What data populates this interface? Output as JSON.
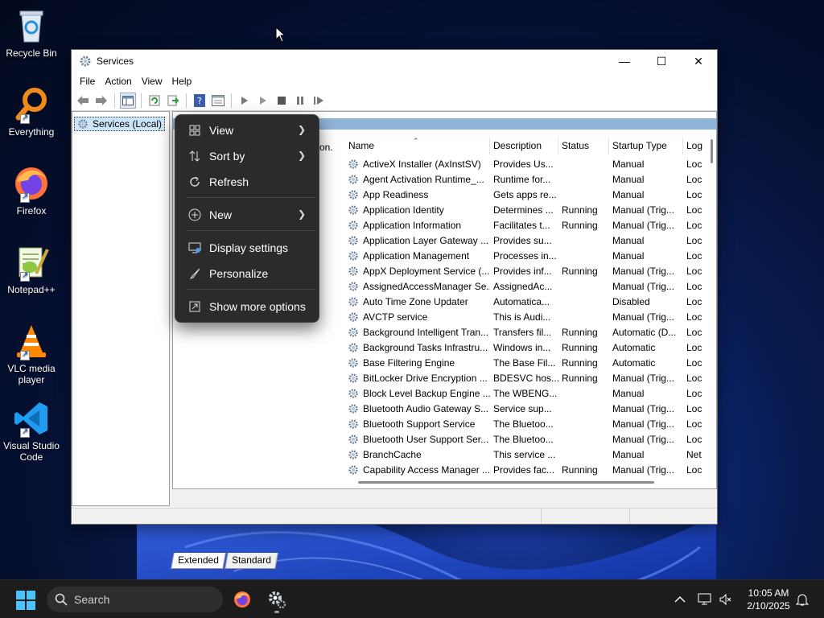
{
  "desktop": {
    "icons": [
      {
        "label": "Recycle Bin",
        "icon": "recycle-bin-icon"
      },
      {
        "label": "Everything",
        "icon": "everything-search-icon"
      },
      {
        "label": "Firefox",
        "icon": "firefox-icon"
      },
      {
        "label": "Notepad++",
        "icon": "notepadpp-icon"
      },
      {
        "label": "VLC media player",
        "icon": "vlc-icon"
      },
      {
        "label": "Visual Studio Code",
        "icon": "vscode-icon"
      }
    ]
  },
  "window": {
    "title": "Services",
    "menu": [
      "File",
      "Action",
      "View",
      "Help"
    ],
    "tree_root": "Services (Local)",
    "desc_stub": "on.",
    "columns": [
      "Name",
      "Description",
      "Status",
      "Startup Type",
      "Log"
    ],
    "services": [
      {
        "name": "ActiveX Installer (AxInstSV)",
        "desc": "Provides Us...",
        "status": "",
        "startup": "Manual",
        "log": "Loc"
      },
      {
        "name": "Agent Activation Runtime_...",
        "desc": "Runtime for...",
        "status": "",
        "startup": "Manual",
        "log": "Loc"
      },
      {
        "name": "App Readiness",
        "desc": "Gets apps re...",
        "status": "",
        "startup": "Manual",
        "log": "Loc"
      },
      {
        "name": "Application Identity",
        "desc": "Determines ...",
        "status": "Running",
        "startup": "Manual (Trig...",
        "log": "Loc"
      },
      {
        "name": "Application Information",
        "desc": "Facilitates t...",
        "status": "Running",
        "startup": "Manual (Trig...",
        "log": "Loc"
      },
      {
        "name": "Application Layer Gateway ...",
        "desc": "Provides su...",
        "status": "",
        "startup": "Manual",
        "log": "Loc"
      },
      {
        "name": "Application Management",
        "desc": "Processes in...",
        "status": "",
        "startup": "Manual",
        "log": "Loc"
      },
      {
        "name": "AppX Deployment Service (...",
        "desc": "Provides inf...",
        "status": "Running",
        "startup": "Manual (Trig...",
        "log": "Loc"
      },
      {
        "name": "AssignedAccessManager Se...",
        "desc": "AssignedAc...",
        "status": "",
        "startup": "Manual (Trig...",
        "log": "Loc"
      },
      {
        "name": "Auto Time Zone Updater",
        "desc": "Automatica...",
        "status": "",
        "startup": "Disabled",
        "log": "Loc"
      },
      {
        "name": "AVCTP service",
        "desc": "This is Audi...",
        "status": "",
        "startup": "Manual (Trig...",
        "log": "Loc"
      },
      {
        "name": "Background Intelligent Tran...",
        "desc": "Transfers fil...",
        "status": "Running",
        "startup": "Automatic (D...",
        "log": "Loc"
      },
      {
        "name": "Background Tasks Infrastru...",
        "desc": "Windows in...",
        "status": "Running",
        "startup": "Automatic",
        "log": "Loc"
      },
      {
        "name": "Base Filtering Engine",
        "desc": "The Base Fil...",
        "status": "Running",
        "startup": "Automatic",
        "log": "Loc"
      },
      {
        "name": "BitLocker Drive Encryption ...",
        "desc": "BDESVC hos...",
        "status": "Running",
        "startup": "Manual (Trig...",
        "log": "Loc"
      },
      {
        "name": "Block Level Backup Engine ...",
        "desc": "The WBENG...",
        "status": "",
        "startup": "Manual",
        "log": "Loc"
      },
      {
        "name": "Bluetooth Audio Gateway S...",
        "desc": "Service sup...",
        "status": "",
        "startup": "Manual (Trig...",
        "log": "Loc"
      },
      {
        "name": "Bluetooth Support Service",
        "desc": "The Bluetoo...",
        "status": "",
        "startup": "Manual (Trig...",
        "log": "Loc"
      },
      {
        "name": "Bluetooth User Support Ser...",
        "desc": "The Bluetoo...",
        "status": "",
        "startup": "Manual (Trig...",
        "log": "Loc"
      },
      {
        "name": "BranchCache",
        "desc": "This service ...",
        "status": "",
        "startup": "Manual",
        "log": "Net"
      },
      {
        "name": "Capability Access Manager ...",
        "desc": "Provides fac...",
        "status": "Running",
        "startup": "Manual (Trig...",
        "log": "Loc"
      }
    ],
    "tabs": [
      "Extended",
      "Standard"
    ]
  },
  "context_menu": {
    "items": [
      {
        "label": "View",
        "icon": "grid-view-icon",
        "submenu": true
      },
      {
        "label": "Sort by",
        "icon": "sort-icon",
        "submenu": true
      },
      {
        "label": "Refresh",
        "icon": "refresh-icon",
        "submenu": false
      },
      {
        "label": "New",
        "icon": "new-plus-icon",
        "submenu": true
      },
      {
        "label": "Display settings",
        "icon": "display-settings-icon",
        "submenu": false
      },
      {
        "label": "Personalize",
        "icon": "personalize-brush-icon",
        "submenu": false
      },
      {
        "label": "Show more options",
        "icon": "show-more-options-icon",
        "submenu": false
      }
    ]
  },
  "taskbar": {
    "search_placeholder": "Search",
    "time": "10:05 AM",
    "date": "2/10/2025"
  },
  "colors": {
    "accent": "#0078d4",
    "menu_bg": "#2b2b2b",
    "taskbar_bg": "#1c1c1c"
  }
}
